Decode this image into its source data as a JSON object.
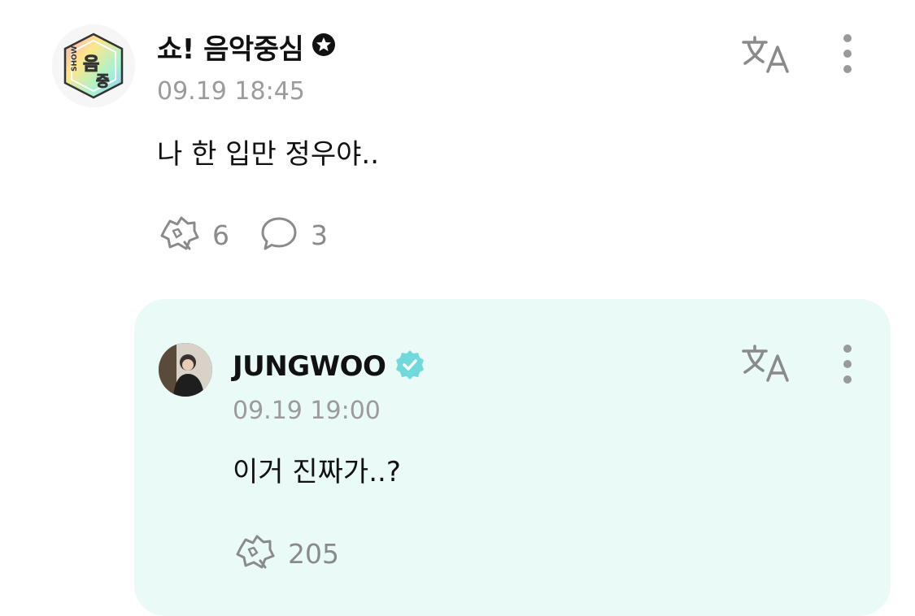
{
  "post": {
    "author": "쇼! 음악중심",
    "avatar_logo_text": "SHOW 음중",
    "time": "09.19 18:45",
    "text": "나 한 입만 정우야..",
    "likes": "6",
    "comments": "3"
  },
  "reply": {
    "author": "JUNGWOO",
    "time": "09.19 19:00",
    "text": "이거 진짜가..?",
    "likes": "205"
  },
  "icons": {
    "verified_official": "star-badge-icon",
    "verified_artist": "check-badge-icon",
    "translate": "translate-icon",
    "more": "more-vertical-icon",
    "like": "bubble-heart-icon",
    "comment": "comment-icon"
  },
  "colors": {
    "reply_background": "#eafaf7",
    "verified_teal": "#6fd9dc",
    "meta_gray": "#9b9b9b"
  }
}
